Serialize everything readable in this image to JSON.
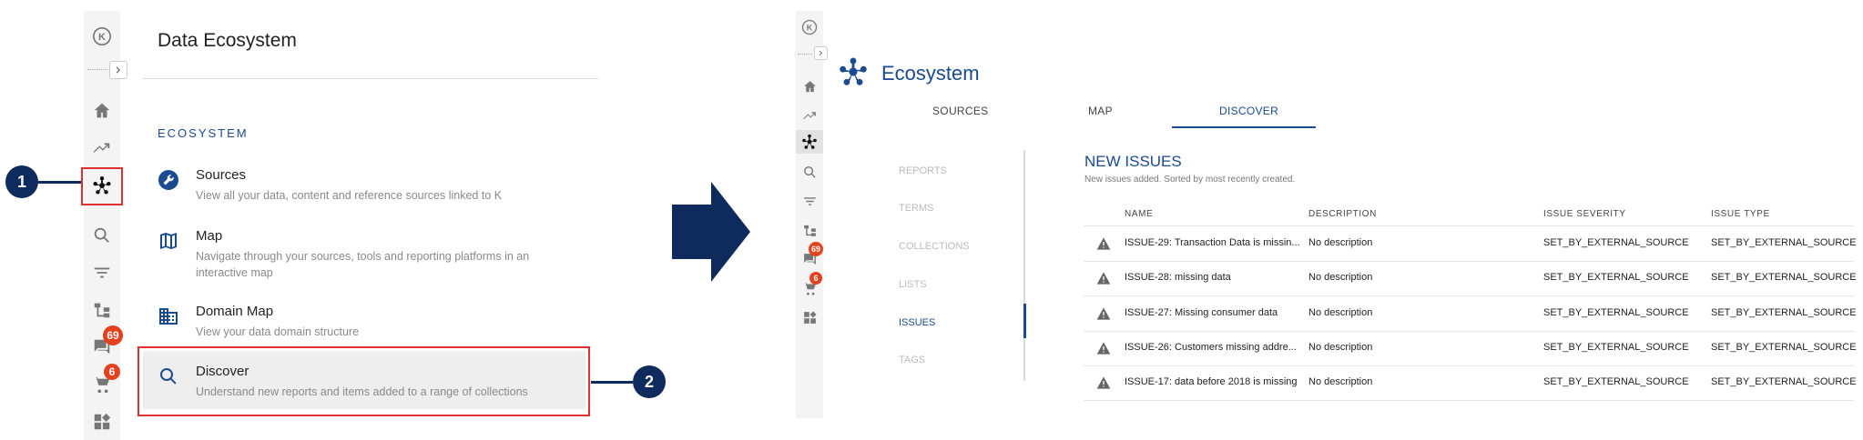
{
  "left_panel": {
    "logo": "K",
    "title": "Data Ecosystem",
    "section_heading": "ECOSYSTEM",
    "items": [
      {
        "icon": "wrench-icon",
        "title": "Sources",
        "desc": "View all your data, content and reference sources linked to K"
      },
      {
        "icon": "map-icon",
        "title": "Map",
        "desc": "Navigate through your sources, tools and reporting platforms in an interactive map"
      },
      {
        "icon": "building-icon",
        "title": "Domain Map",
        "desc": "View your data domain structure"
      },
      {
        "icon": "search-icon",
        "title": "Discover",
        "desc": "Understand new reports and items added to a range of collections"
      }
    ],
    "badges": {
      "messages": "69",
      "cart": "6"
    }
  },
  "annotations": {
    "step1": "1",
    "step2": "2",
    "highlight_color": "#e0302f",
    "step_color": "#0f2a5c"
  },
  "right_panel": {
    "logo": "K",
    "title": "Ecosystem",
    "tabs": [
      "SOURCES",
      "MAP",
      "DISCOVER"
    ],
    "active_tab": "DISCOVER",
    "subnav": [
      "REPORTS",
      "TERMS",
      "COLLECTIONS",
      "LISTS",
      "ISSUES",
      "TAGS"
    ],
    "active_subnav": "ISSUES",
    "badges": {
      "messages": "69",
      "cart": "6"
    },
    "issues": {
      "title": "NEW ISSUES",
      "subtitle": "New issues added. Sorted by most recently created.",
      "columns": [
        "NAME",
        "DESCRIPTION",
        "ISSUE SEVERITY",
        "ISSUE TYPE"
      ],
      "rows": [
        {
          "name": "ISSUE-29: Transaction Data is missin...",
          "description": "No description",
          "severity": "SET_BY_EXTERNAL_SOURCE",
          "type": "SET_BY_EXTERNAL_SOURCE"
        },
        {
          "name": "ISSUE-28: missing data",
          "description": "No description",
          "severity": "SET_BY_EXTERNAL_SOURCE",
          "type": "SET_BY_EXTERNAL_SOURCE"
        },
        {
          "name": "ISSUE-27: Missing consumer data",
          "description": "No description",
          "severity": "SET_BY_EXTERNAL_SOURCE",
          "type": "SET_BY_EXTERNAL_SOURCE"
        },
        {
          "name": "ISSUE-26: Customers missing addre...",
          "description": "No description",
          "severity": "SET_BY_EXTERNAL_SOURCE",
          "type": "SET_BY_EXTERNAL_SOURCE"
        },
        {
          "name": "ISSUE-17: data before 2018 is missing",
          "description": "No description",
          "severity": "SET_BY_EXTERNAL_SOURCE",
          "type": "SET_BY_EXTERNAL_SOURCE"
        }
      ]
    }
  },
  "colors": {
    "accent": "#1a4a8f",
    "badge": "#e4411e"
  }
}
